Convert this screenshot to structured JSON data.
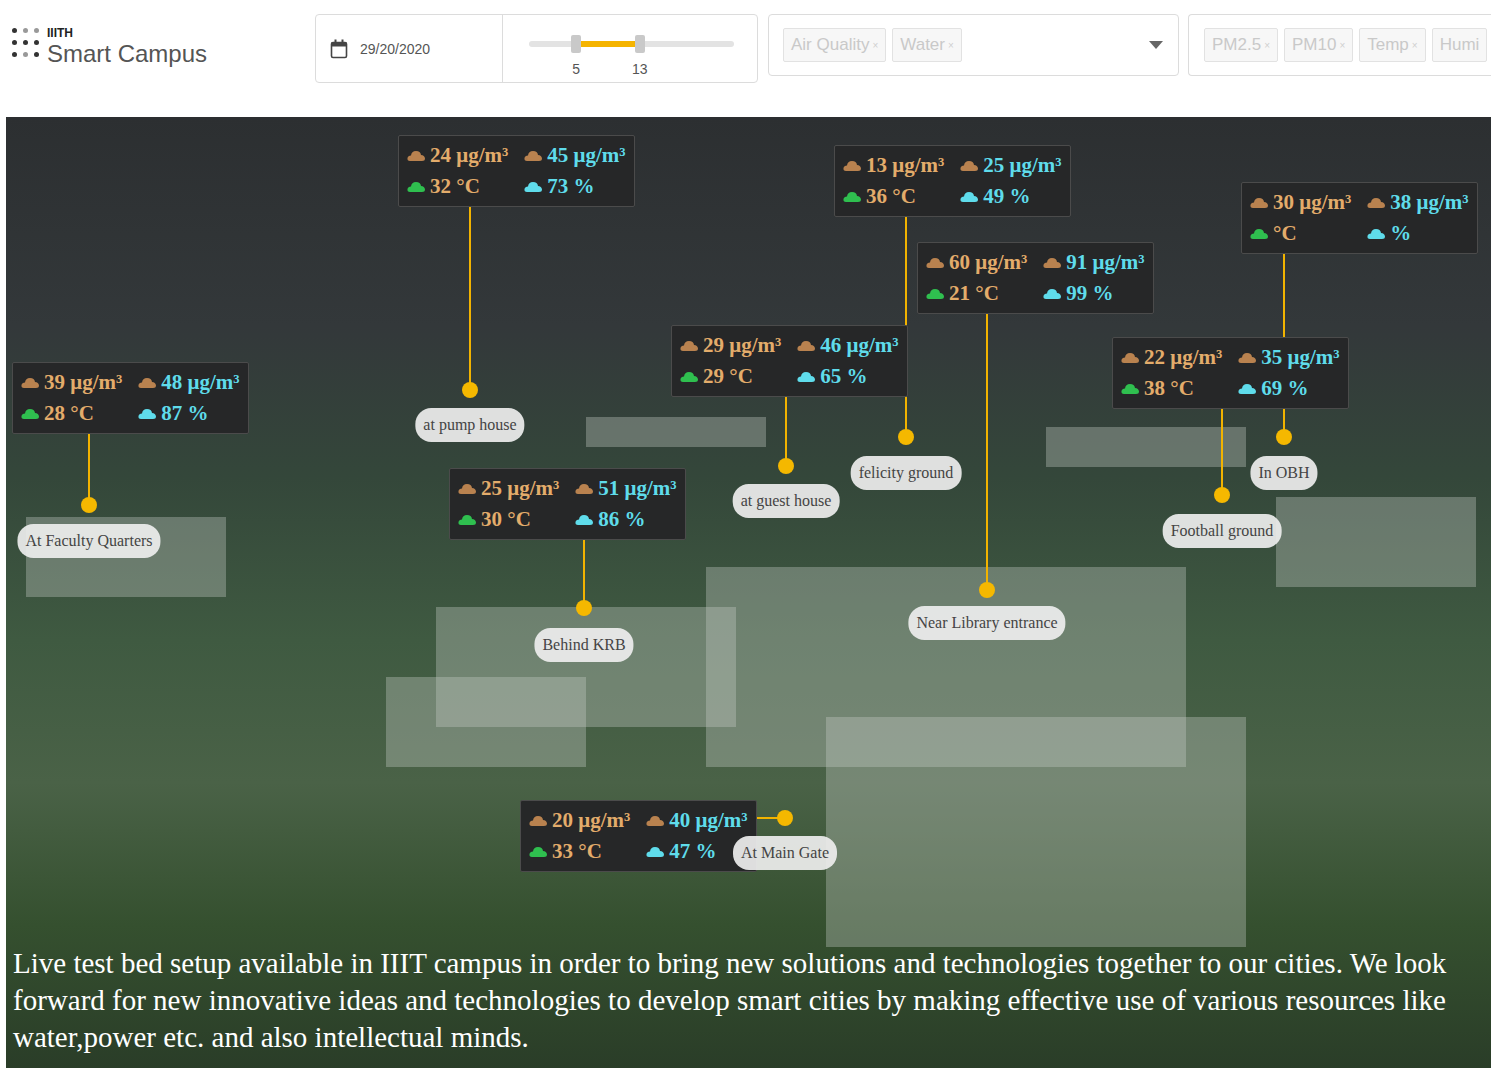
{
  "app": {
    "brand": "IIITH",
    "title": "Smart Campus"
  },
  "date": {
    "value": "29/20/2020"
  },
  "range": {
    "start": 0.23,
    "end": 0.54,
    "min_label": "5",
    "max_label": "13"
  },
  "categories": {
    "chips": [
      {
        "label": "Air Quality",
        "remove": "×",
        "disabled": true
      },
      {
        "label": "Water",
        "remove": "×",
        "disabled": true
      }
    ]
  },
  "metrics": {
    "chips": [
      {
        "label": "PM2.5",
        "remove": "×",
        "disabled": true
      },
      {
        "label": "PM10",
        "remove": "×",
        "disabled": true
      },
      {
        "label": "Temp",
        "remove": "×",
        "disabled": true
      },
      {
        "label": "Humi",
        "disabled": true
      }
    ]
  },
  "sensors": [
    {
      "location": "At Faculty Quarters",
      "pm25": "39 μg/m³",
      "pm10": "48 μg/m³",
      "temp": "28 °C",
      "humidity": "87 %"
    },
    {
      "location": "at pump house",
      "pm25": "24 μg/m³",
      "pm10": "45 μg/m³",
      "temp": "32 °C",
      "humidity": "73 %"
    },
    {
      "location": "Behind KRB",
      "pm25": "25 μg/m³",
      "pm10": "51 μg/m³",
      "temp": "30 °C",
      "humidity": "86 %"
    },
    {
      "location": "at guest house",
      "pm25": "29 μg/m³",
      "pm10": "46 μg/m³",
      "temp": "29 °C",
      "humidity": "65 %"
    },
    {
      "location": "felicity ground",
      "pm25": "13 μg/m³",
      "pm10": "25 μg/m³",
      "temp": "36 °C",
      "humidity": "49 %"
    },
    {
      "location": "Near Library entrance",
      "pm25": "60 μg/m³",
      "pm10": "91 μg/m³",
      "temp": "21 °C",
      "humidity": "99 %"
    },
    {
      "location": "In OBH",
      "pm25": "30 μg/m³",
      "pm10": "38 μg/m³",
      "temp": "°C",
      "humidity": "%"
    },
    {
      "location": "Football ground",
      "pm25": "22 μg/m³",
      "pm10": "35 μg/m³",
      "temp": "38 °C",
      "humidity": "69 %"
    },
    {
      "location": "At Main Gate",
      "pm25": "20 μg/m³",
      "pm10": "40 μg/m³",
      "temp": "33 °C",
      "humidity": "47 %"
    }
  ],
  "caption": "Live test bed setup available in  IIIT campus in  order to bring new solutions and technologies  together to our cities. We look forward for new innovative ideas and technologies to develop smart cities by making effective use of various resources like water,power etc. and also intellectual minds."
}
